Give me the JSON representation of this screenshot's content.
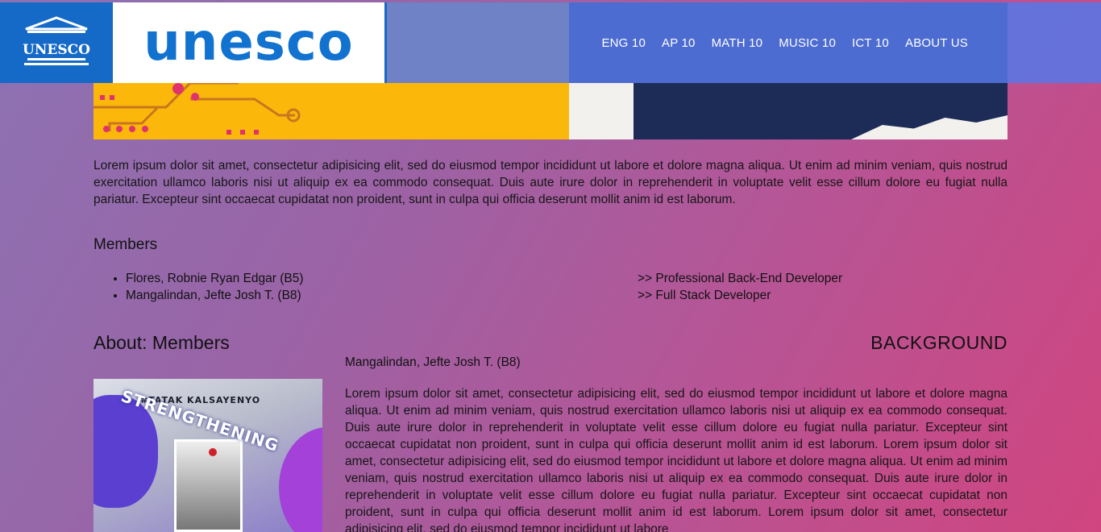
{
  "header": {
    "emblem_text": "UNESCO",
    "logo_word": "unesco",
    "nav": [
      "ENG 10",
      "AP 10",
      "MATH 10",
      "MUSIC 10",
      "ICT 10",
      "ABOUT US"
    ]
  },
  "intro": "Lorem ipsum dolor sit amet, consectetur adipisicing elit, sed do eiusmod tempor incididunt ut labore et dolore magna aliqua. Ut enim ad minim veniam, quis nostrud exercitation ullamco laboris nisi ut aliquip ex ea commodo consequat. Duis aute irure dolor in reprehenderit in voluptate velit esse cillum dolore eu fugiat nulla pariatur. Excepteur sint occaecat cupidatat non proident, sunt in culpa qui officia deserunt mollit anim id est laborum.",
  "members_section": {
    "title": "Members",
    "members": [
      {
        "name": "Flores, Robnie Ryan Edgar (B5)",
        "role": ">> Professional Back-End Developer"
      },
      {
        "name": "Mangalindan, Jefte Josh T. (B8)",
        "role": ">> Full Stack Developer"
      }
    ]
  },
  "about": {
    "title": "About: Members",
    "background_title": "BACKGROUND",
    "member_name": "Mangalindan, Jefte Josh T. (B8)",
    "bio": "Lorem ipsum dolor sit amet, consectetur adipisicing elit, sed do eiusmod tempor incididunt ut labore et dolore magna aliqua. Ut enim ad minim veniam, quis nostrud exercitation ullamco laboris nisi ut aliquip ex ea commodo consequat. Duis aute irure dolor in reprehenderit in voluptate velit esse cillum dolore eu fugiat nulla pariatur. Excepteur sint occaecat cupidatat non proident, sunt in culpa qui officia deserunt mollit anim id est laborum. Lorem ipsum dolor sit amet, consectetur adipisicing elit, sed do eiusmod tempor incididunt ut labore et dolore magna aliqua. Ut enim ad minim veniam, quis nostrud exercitation ullamco laboris nisi ut aliquip ex ea commodo consequat. Duis aute irure dolor in reprehenderit in voluptate velit esse cillum dolore eu fugiat nulla pariatur. Excepteur sint occaecat cupidatat non proident, sunt in culpa qui officia deserunt mollit anim id est laborum. Lorem ipsum dolor sit amet, consectetur adipisicing elit, sed do eiusmod tempor incididunt ut labore",
    "poster": {
      "tag": "#TATAK KALSAYENYO",
      "headline": "STRENGTHENING"
    }
  },
  "colors": {
    "header_bg": "#5678e6",
    "logo_blue": "#1272cf",
    "hero_yellow": "#fbb80a",
    "gradient_start": "#8d72b3",
    "gradient_end": "#d0457f"
  }
}
